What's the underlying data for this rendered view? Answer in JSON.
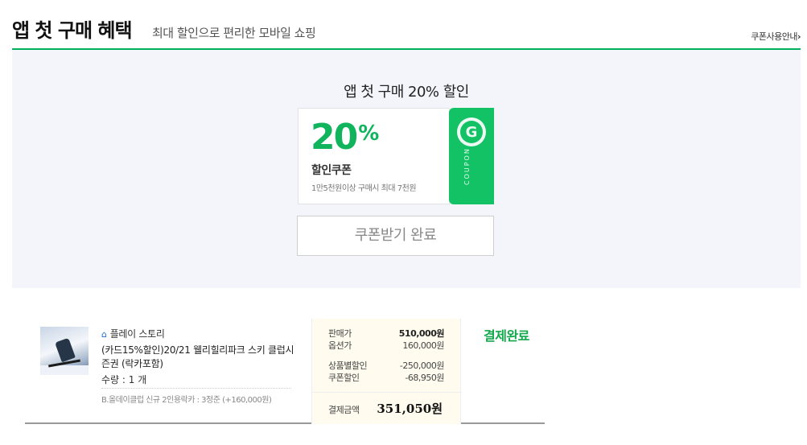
{
  "header": {
    "title": "앱 첫 구매 혜택",
    "subtitle": "최대 할인으로 편리한 모바일 쇼핑",
    "guide_link": "쿠폰사용안내",
    "guide_chevron": "›"
  },
  "coupon": {
    "heading": "앱 첫 구매 20% 할인",
    "percent": "20",
    "percent_sign": "%",
    "name": "할인쿠폰",
    "condition": "1만5천원이상 구매시 최대 7천원",
    "badge_letter": "G",
    "side_text": "COUPON",
    "accent_color": "#14c266",
    "receive_button": "쿠폰받기 완료"
  },
  "order": {
    "shop_icon": "home-icon",
    "shop_name": "플레이 스토리",
    "product_name": "(카드15%할인)20/21 웰리힐리파크 스키 클럽시즌권 (락카포함)",
    "quantity": "수량 : 1 개",
    "option": "B.올데이클럽 신규 2인용락카 : 3정준 (+160,000원)",
    "prices": {
      "sale_label": "판매가",
      "sale_value": "510,000원",
      "option_label": "옵션가",
      "option_value": "160,000원",
      "product_discount_label": "상품별할인",
      "product_discount_value": "-250,000원",
      "coupon_discount_label": "쿠폰할인",
      "coupon_discount_value": "-68,950원",
      "total_label": "결제금액",
      "total_value": "351,050원"
    },
    "status": "결제완료",
    "status_color": "#12a84b"
  }
}
